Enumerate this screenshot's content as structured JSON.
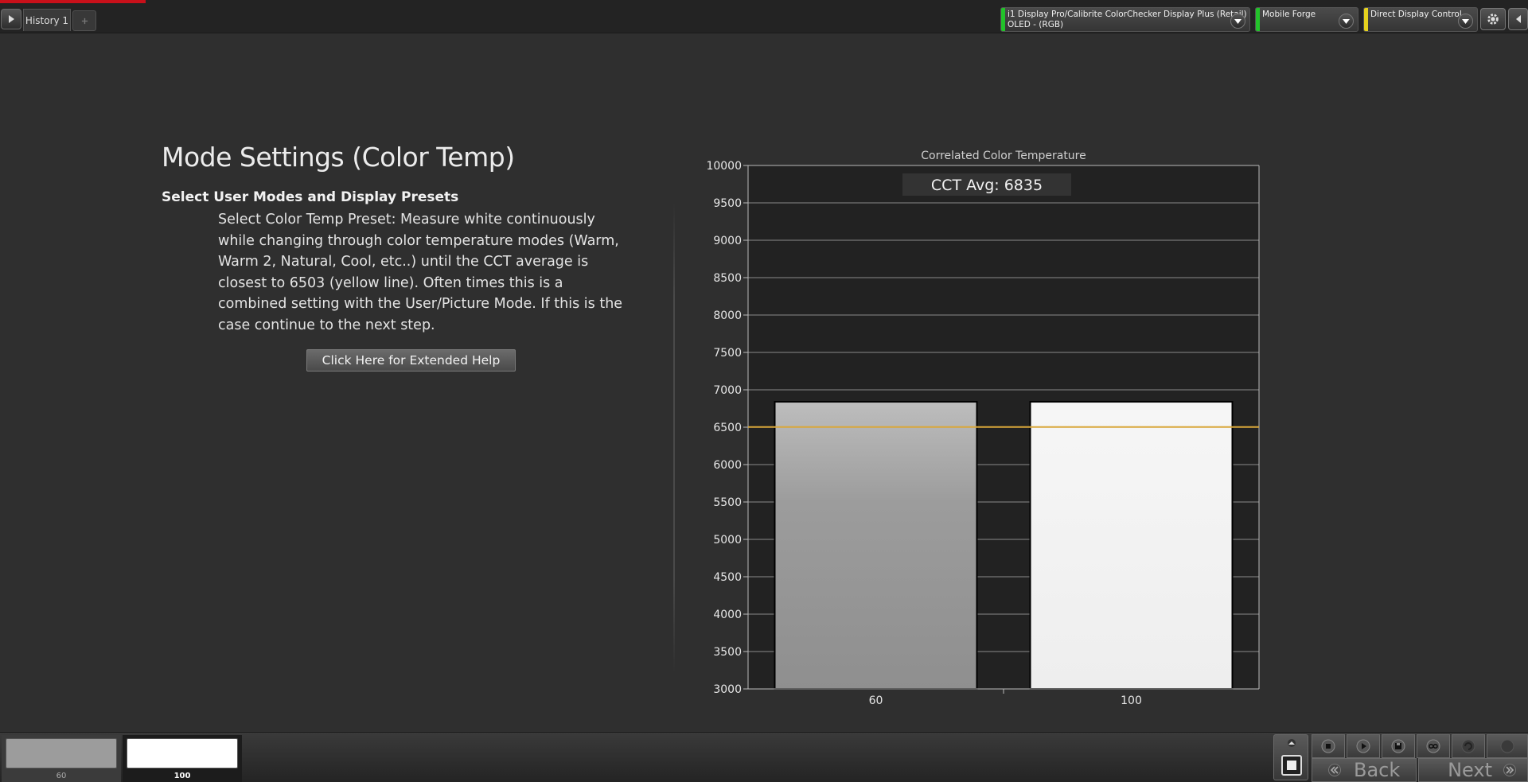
{
  "topbar": {
    "history_tab": "History 1",
    "devices": [
      {
        "line1": "i1 Display Pro/Calibrite ColorChecker Display Plus (Retail)",
        "line2": "OLED - (RGB)",
        "status_color": "#22c32a"
      },
      {
        "line1": "Mobile Forge",
        "line2": "",
        "status_color": "#22c32a"
      },
      {
        "line1": "Direct Display Control",
        "line2": "",
        "status_color": "#e6d21e"
      }
    ]
  },
  "content": {
    "title": "Mode Settings (Color Temp)",
    "subtitle": "Select User Modes and Display Presets",
    "body": "Select Color Temp Preset: Measure white continuously while changing through color temperature modes (Warm, Warm 2, Natural, Cool, etc..) until the CCT average is closest to 6503 (yellow line). Often times this is a combined setting with the User/Picture Mode. If this is the case continue to the next step.",
    "help_button": "Click Here for Extended Help"
  },
  "chart_data": {
    "type": "bar",
    "title": "Correlated Color Temperature",
    "annotation": "CCT Avg: 6835",
    "categories": [
      "60",
      "100"
    ],
    "values": [
      6840,
      6840
    ],
    "bar_colors": [
      "#9c9c9c",
      "#f2f2f2"
    ],
    "target_line": 6503,
    "target_color": "#d9a73a",
    "ylim": [
      3000,
      10000
    ],
    "yticks": [
      3000,
      3500,
      4000,
      4500,
      5000,
      5500,
      6000,
      6500,
      7000,
      7500,
      8000,
      8500,
      9000,
      9500,
      10000
    ],
    "grid": true
  },
  "bottombar": {
    "patches": [
      {
        "label": "60",
        "color": "#9c9c9c"
      },
      {
        "label": "100",
        "color": "#ffffff"
      }
    ],
    "back_label": "Back",
    "next_label": "Next"
  }
}
